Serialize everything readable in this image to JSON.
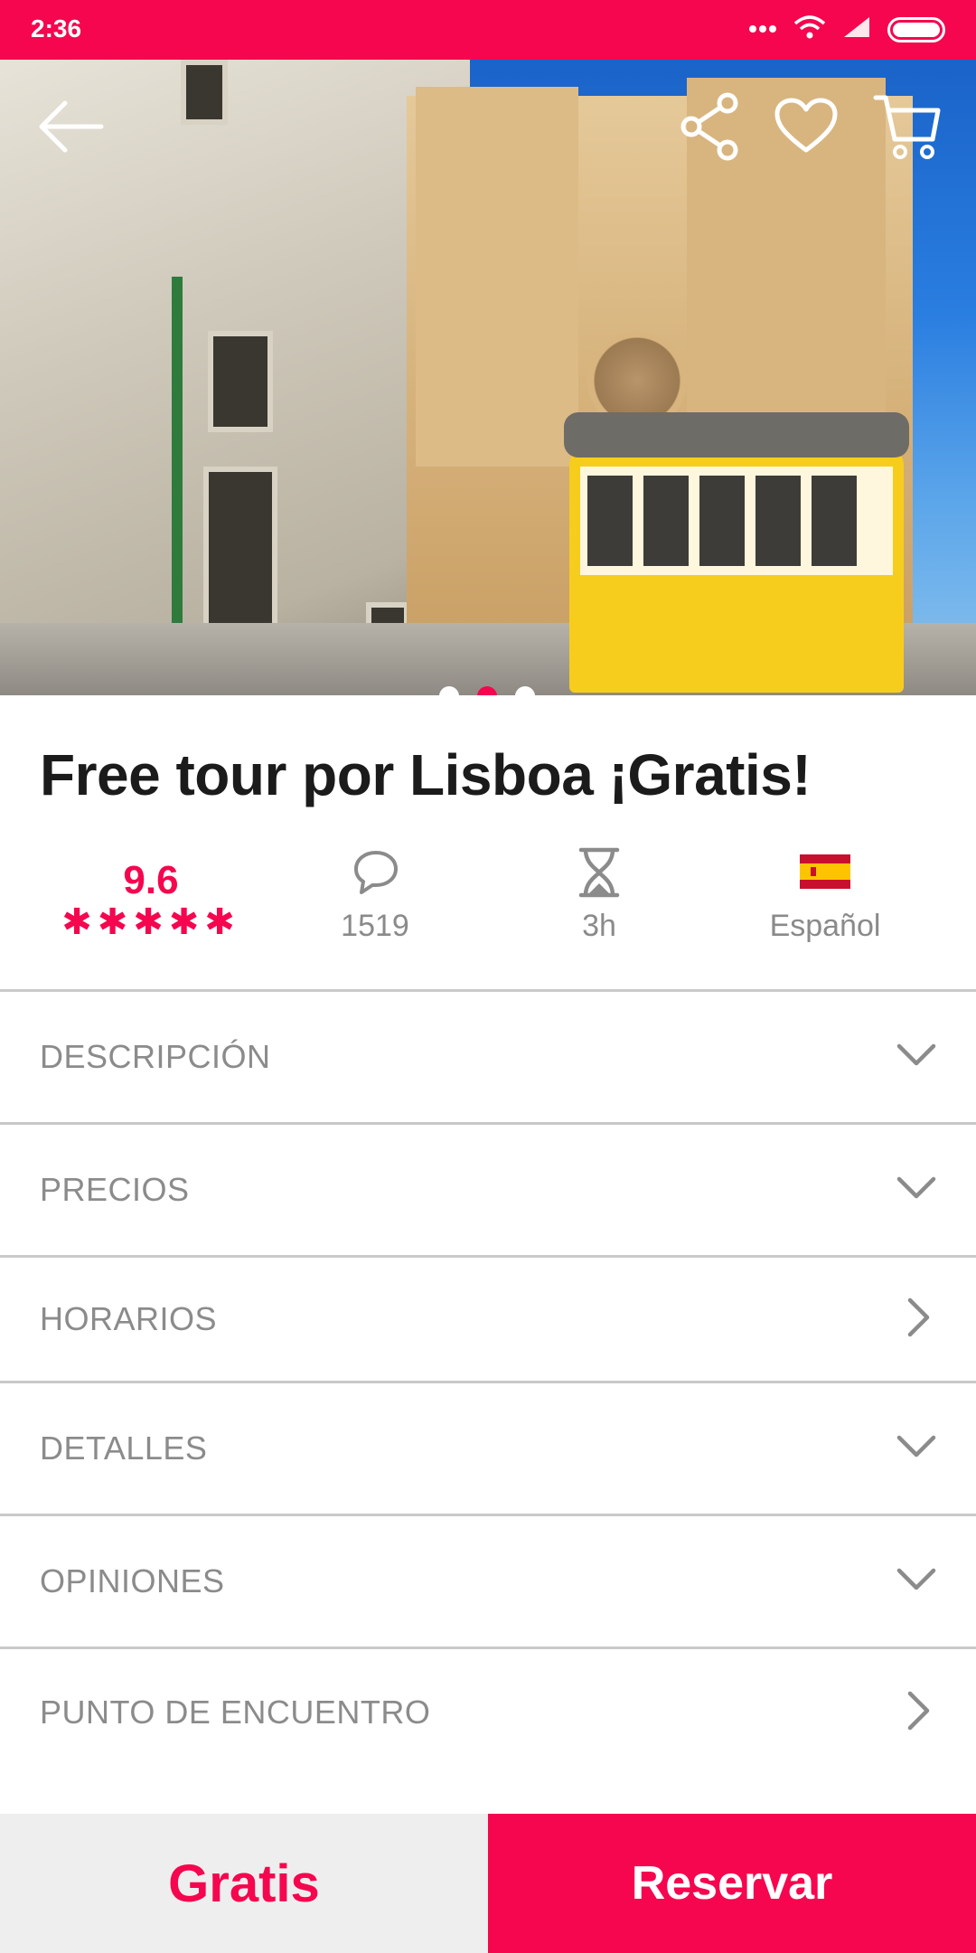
{
  "status_bar": {
    "time": "2:36",
    "icons": [
      "more-dots-icon",
      "wifi-icon",
      "signal-icon",
      "battery-icon"
    ]
  },
  "hero": {
    "image_description_icon": "photo-lisbon-cathedral-tram",
    "carousel": {
      "count": 3,
      "active_index": 1
    },
    "actions": [
      "back-icon",
      "share-icon",
      "heart-icon",
      "cart-icon"
    ]
  },
  "tour": {
    "title": "Free tour por Lisboa ¡Gratis!",
    "rating": "9.6",
    "stars": "✱✱✱✱✱",
    "reviews": "1519",
    "duration": "3h",
    "language": "Español"
  },
  "sections": [
    {
      "label": "DESCRIPCIÓN",
      "chevron": "chevron-down"
    },
    {
      "label": "PRECIOS",
      "chevron": "chevron-down"
    },
    {
      "label": "HORARIOS",
      "chevron": "chevron-right"
    },
    {
      "label": "DETALLES",
      "chevron": "chevron-down"
    },
    {
      "label": "OPINIONES",
      "chevron": "chevron-down"
    },
    {
      "label": "PUNTO DE ENCUENTRO",
      "chevron": "chevron-right"
    }
  ],
  "footer": {
    "price": "Gratis",
    "book_label": "Reservar"
  },
  "colors": {
    "accent": "#f5064e",
    "text_dark": "#1b1b1b",
    "text_gray": "#8b8b8b"
  }
}
